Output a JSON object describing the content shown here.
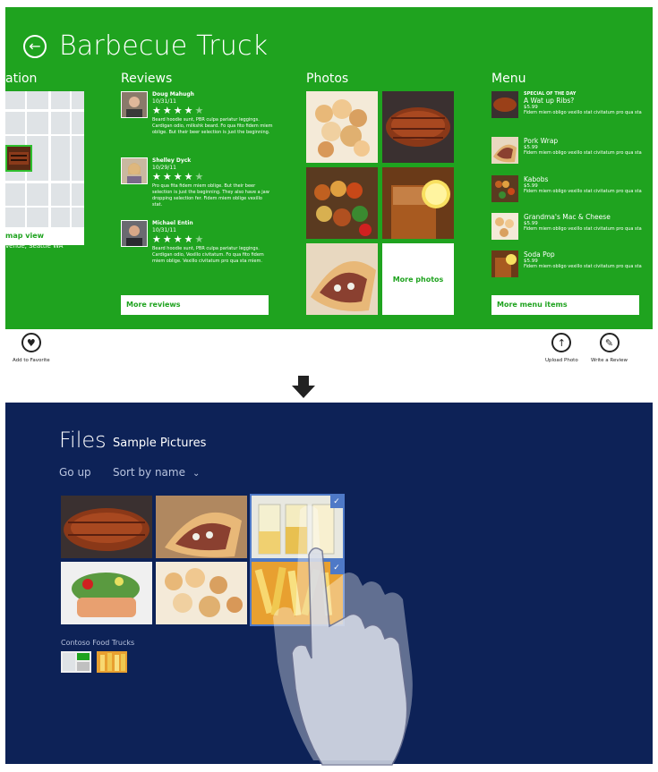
{
  "app": {
    "title": "Barbecue Truck",
    "sections": {
      "location": "ation",
      "reviews": "Reviews",
      "photos": "Photos",
      "menu": "Menu"
    },
    "location": {
      "map_link": "map view",
      "address": "venue, Seattle WA"
    },
    "reviews": [
      {
        "name": "Doug Mahugh",
        "date": "10/31/11",
        "rating": 4,
        "text": "Beard hoodie sunt, PBR culpa pariatur leggings. Cardigan odio, milkshk beard. Fo qua fito fidem miem oblige. But their beer selection is just the beginning."
      },
      {
        "name": "Shelley Dyck",
        "date": "10/29/11",
        "rating": 4,
        "text": "Pro qua fita fidem miem oblige. But their beer selection is just the beginning. They also have a jaw dropping selection fer. Fidem miem oblige vexillo stat."
      },
      {
        "name": "Michael Entin",
        "date": "10/31/11",
        "rating": 4,
        "text": "Beard hoodie sunt, PBR culpa pariatur leggings. Cardigan odio, Vexillo civitatum. Fo qua fito fidem miem oblige. Vexillo civitatum pro qua sta miem."
      }
    ],
    "more_reviews": "More reviews",
    "more_photos": "More photos",
    "menu": [
      {
        "special": "SPECIAL OF THE DAY",
        "name": "A Wat up Ribs?",
        "price": "$5.99",
        "desc": "Fidem miem obligo vexillo stat civitatum pro qua sta"
      },
      {
        "special": "",
        "name": "Pork Wrap",
        "price": "$5.99",
        "desc": "Fidem miem obligo vexillo stat civitatum pro qua sta"
      },
      {
        "special": "",
        "name": "Kabobs",
        "price": "$5.99",
        "desc": "Fidem miem obligo vexillo stat civitatum pro qua sta"
      },
      {
        "special": "",
        "name": "Grandma's Mac & Cheese",
        "price": "$5.99",
        "desc": "Fidem miem obligo vexillo stat civitatum pro qua sta"
      },
      {
        "special": "",
        "name": "Soda Pop",
        "price": "$5.99",
        "desc": "Fidem miem obligo vexillo stat civitatum pro qua sta"
      }
    ],
    "more_menu": "More menu items"
  },
  "appbar": {
    "add_favorite": "Add to Favorite",
    "upload_photo": "Upload Photo",
    "write_review": "Write a Review"
  },
  "picker": {
    "title": "Files",
    "subtitle": "Sample Pictures",
    "go_up": "Go up",
    "sort_by": "Sort by name",
    "group_label": "Contoso Food Trucks"
  },
  "colors": {
    "app_green": "#1fa31f",
    "picker_navy": "#0d2257",
    "selection_blue": "#4e79c7"
  },
  "icons": [
    "back-arrow-icon",
    "heart-icon",
    "upload-icon",
    "pencil-icon",
    "down-arrow-icon",
    "chevron-down-icon",
    "checkmark-icon",
    "hand-gesture-icon"
  ]
}
